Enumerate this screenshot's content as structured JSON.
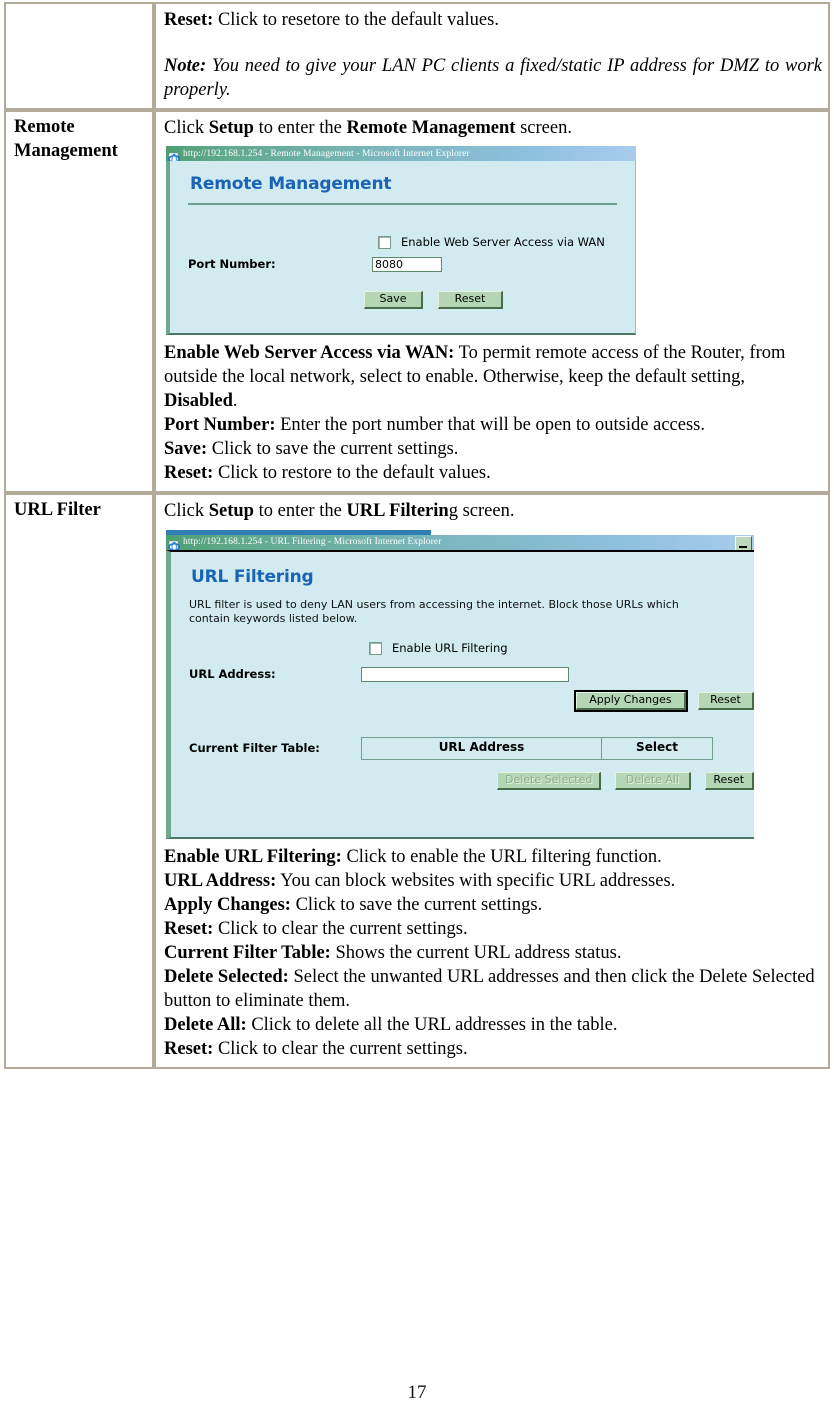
{
  "page": {
    "number": "17"
  },
  "table": {
    "rows": [
      {
        "label": "",
        "body": {
          "reset_term": "Reset:",
          "reset_text": " Click to resetore to the default values.",
          "note_term": "Note:",
          "note_text": " You need to give your LAN PC clients a fixed/static IP address for DMZ to work properly."
        }
      },
      {
        "label": "Remote Management",
        "intro": {
          "pre": "Click ",
          "bold1": "Setup",
          "mid": " to enter the ",
          "bold2": "Remote Management",
          "post": " screen."
        },
        "screenshot": {
          "window_title": "http://192.168.1.254 - Remote Management - Microsoft Internet Explorer",
          "icon": "ie-page-icon",
          "heading": "Remote Management",
          "checkbox_label": "Enable Web Server Access via WAN",
          "checkbox_checked": false,
          "port_label": "Port Number:",
          "port_value": "8080",
          "buttons": [
            "Save",
            "Reset"
          ]
        },
        "descriptions": [
          {
            "term": "Enable Web Server Access via WAN:",
            "text": " To permit remote access of the Router, from outside the local network, select to enable. Otherwise, keep the default setting, ",
            "bold_tail": "Disabled",
            "tail": "."
          },
          {
            "term": "Port Number:",
            "text": " Enter the port number that will be open to outside access."
          },
          {
            "term": "Save:",
            "text": " Click to save the current settings."
          },
          {
            "term": "Reset:",
            "text": " Click to restore to the default values."
          }
        ]
      },
      {
        "label": "URL Filter",
        "intro": {
          "pre": "Click ",
          "bold1": "Setup",
          "mid": " to enter the ",
          "bold2": "URL Filterin",
          "post": "g screen."
        },
        "screenshot": {
          "window_title": "http://192.168.1.254 - URL Filtering - Microsoft Internet Explorer",
          "icon": "ie-page-icon",
          "minimize_icon": "minimize-icon",
          "heading": "URL Filtering",
          "description": "URL filter is used to deny LAN users from accessing the internet. Block those URLs which contain keywords listed below.",
          "checkbox_label": "Enable URL Filtering",
          "checkbox_checked": false,
          "url_label": "URL Address:",
          "url_value": "",
          "apply_button": "Apply Changes",
          "reset_button_1": "Reset",
          "filter_table_label": "Current Filter Table:",
          "filter_table_headers": [
            "URL Address",
            "Select"
          ],
          "delete_selected_button": "Delete Selected",
          "delete_all_button": "Delete All",
          "reset_button_2": "Reset"
        },
        "descriptions": [
          {
            "term": "Enable URL Filtering:",
            "text": " Click to enable the URL filtering function."
          },
          {
            "term": "URL Address:",
            "text": " You can block websites with specific URL addresses."
          },
          {
            "term": "Apply Changes:",
            "text": " Click to save the current settings."
          },
          {
            "term": "Reset:",
            "text": " Click to clear the current settings."
          },
          {
            "term": "Current Filter Table:",
            "text": " Shows the current URL address status."
          },
          {
            "term": "Delete Selected:",
            "text": " Select the unwanted URL addresses and then click the Delete Selected button to eliminate them."
          },
          {
            "term": "Delete All:",
            "text": " Click to delete all the URL addresses in the table."
          },
          {
            "term": "Reset:",
            "text": " Click to clear the current settings."
          }
        ]
      }
    ]
  },
  "colors": {
    "table_border": "#b3ab99",
    "router_bg": "#d2ebf0",
    "router_heading": "#1a63b5",
    "button_face": "#b5d6b5"
  }
}
